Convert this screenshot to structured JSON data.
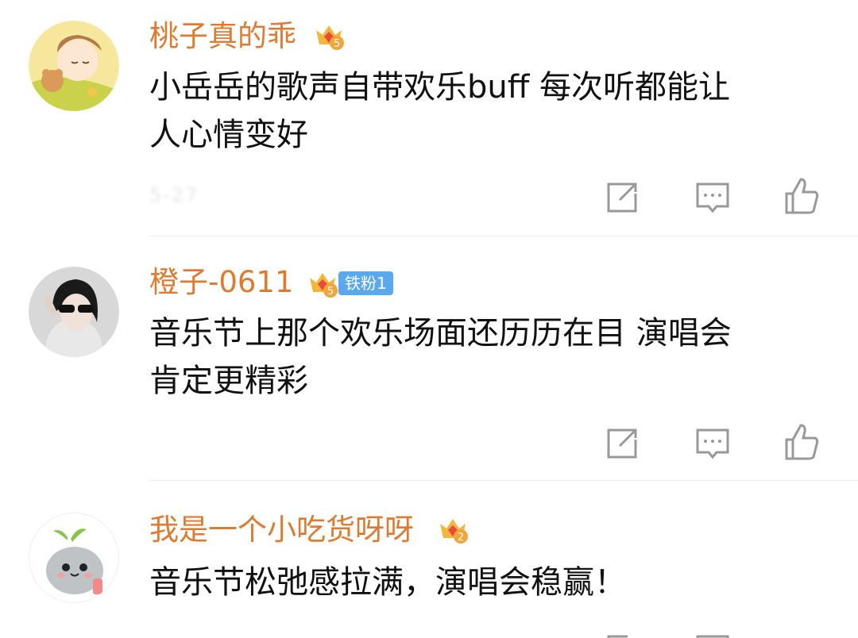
{
  "comments": [
    {
      "username": "桃子真的乖",
      "crown_level": "5",
      "text_lines": [
        "小岳岳的歌声自带欢乐buff 每次听都能让",
        "人心情变好"
      ],
      "meta": "5-27"
    },
    {
      "username": "橙子-0611",
      "crown_level": "5",
      "fan_badge": "铁粉1",
      "text_lines": [
        "音乐节上那个欢乐场面还历历在目 演唱会",
        "肯定更精彩"
      ]
    },
    {
      "username": "我是一个小吃货呀呀",
      "crown_level": "2",
      "text_lines": [
        "音乐节松弛感拉满，演唱会稳赢！"
      ]
    }
  ],
  "icons": {
    "share": "share-icon",
    "reply": "comment-icon",
    "like": "like-icon"
  },
  "colors": {
    "username": "#e07a2e",
    "text": "#111111",
    "icon": "#999999",
    "fan_badge": "#5aa9ef"
  }
}
